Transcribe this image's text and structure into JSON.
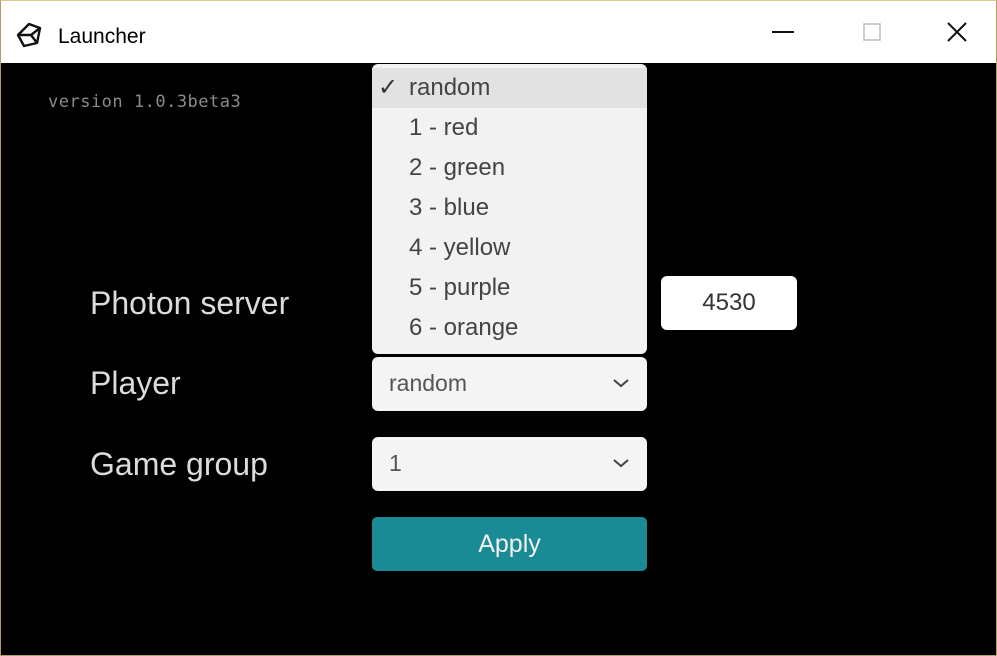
{
  "window": {
    "title": "Launcher",
    "icon": "unity-logo-icon",
    "controls": [
      "minimize-icon",
      "maximize-icon",
      "close-icon"
    ]
  },
  "app": {
    "version": "version 1.0.3beta3"
  },
  "form": {
    "server_label": "Photon server",
    "player_label": "Player",
    "group_label": "Game group",
    "port_value": "4530",
    "player_value": "random",
    "group_value": "1",
    "apply_label": "Apply"
  },
  "player_dropdown": {
    "options": [
      {
        "label": "random",
        "selected": true,
        "check": "✓"
      },
      {
        "label": "1 - red",
        "selected": false
      },
      {
        "label": "2 - green",
        "selected": false
      },
      {
        "label": "3 - blue",
        "selected": false
      },
      {
        "label": "4 - yellow",
        "selected": false
      },
      {
        "label": "5 - purple",
        "selected": false
      },
      {
        "label": "6 - orange",
        "selected": false
      }
    ]
  },
  "colors": {
    "background": "#000000",
    "accent": "#1a8a94",
    "label_text": "#dcdcdc"
  }
}
